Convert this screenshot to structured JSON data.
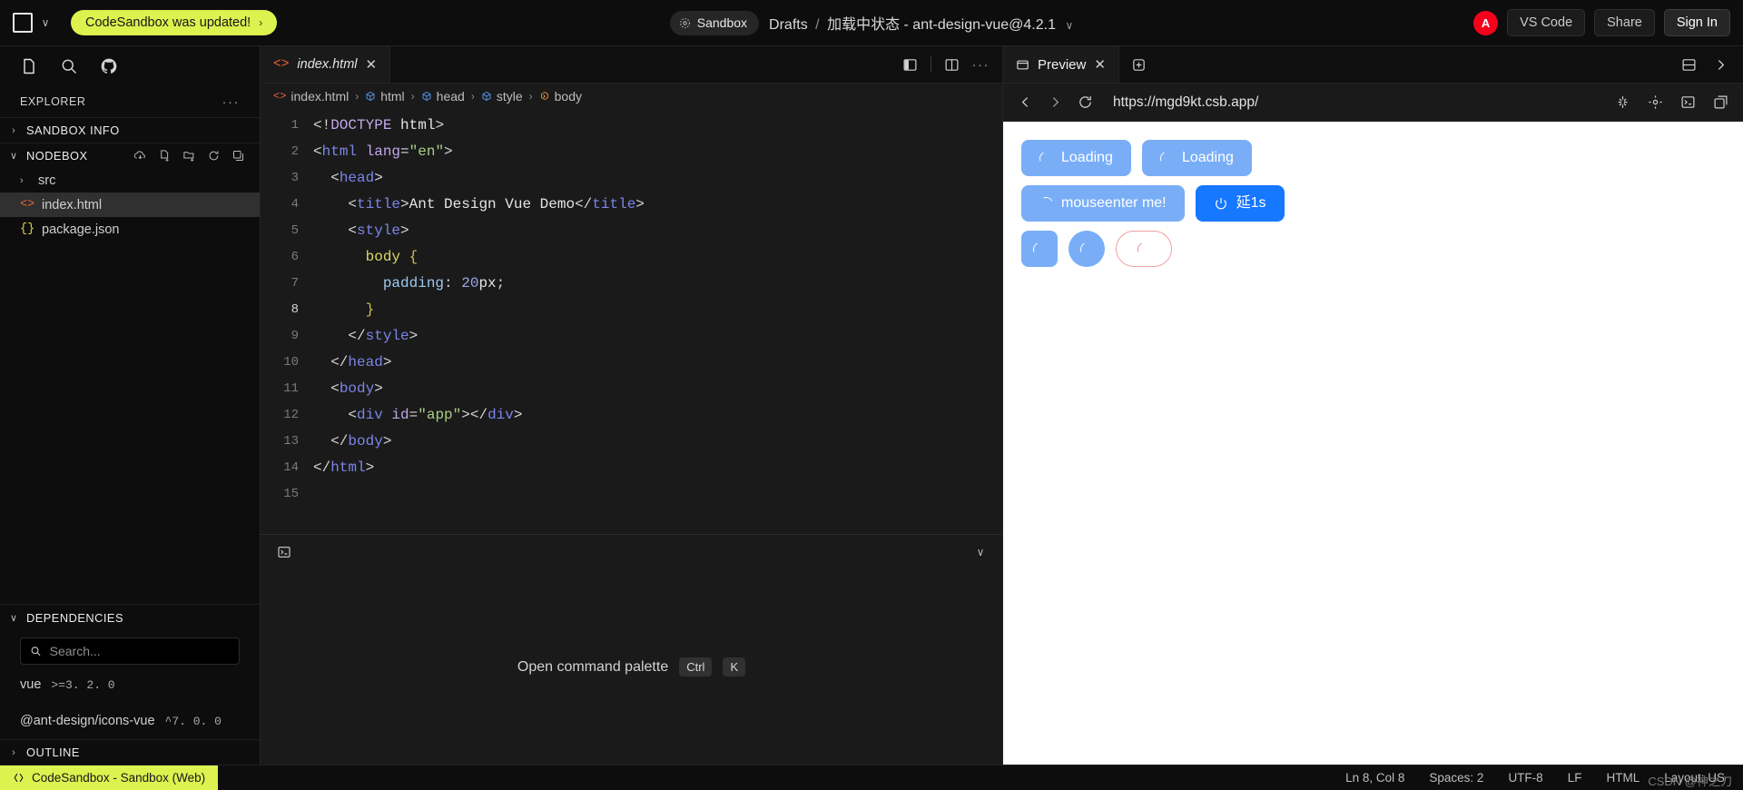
{
  "titlebar": {
    "logo_alt": "CodeSandbox logo",
    "update_banner": "CodeSandbox was updated!",
    "update_arrow": "›",
    "sandbox_chip": "Sandbox",
    "breadcrumb_root": "Drafts",
    "breadcrumb_sep": "/",
    "breadcrumb_name": "加载中状态 - ant-design-vue@4.2.1",
    "title_chevron": "∨",
    "avatar_initial": "A",
    "vscode_button": "VS Code",
    "share_button": "Share",
    "signin_button": "Sign In",
    "accent": "#dcf24f"
  },
  "sidebar": {
    "explorer_label": "EXPLORER",
    "explorer_more": "···",
    "sections": [
      {
        "label": "SANDBOX INFO",
        "caret": "›",
        "expanded": false
      },
      {
        "label": "NODEBOX",
        "caret": "∨",
        "expanded": true
      }
    ],
    "files": [
      {
        "name": "src",
        "type": "folder",
        "caret": "›",
        "icon": "",
        "active": false
      },
      {
        "name": "index.html",
        "type": "file",
        "icon": "<>",
        "active": true
      },
      {
        "name": "package.json",
        "type": "file",
        "icon": "{}",
        "active": false
      }
    ],
    "dependencies_label": "DEPENDENCIES",
    "dependencies_caret": "∨",
    "search_placeholder": "Search...",
    "dependencies": [
      {
        "name": "vue",
        "version": ">=3. 2. 0"
      },
      {
        "name": "@ant-design/icons-vue",
        "version": "^7. 0. 0"
      }
    ],
    "outline_label": "OUTLINE",
    "outline_caret": "›"
  },
  "editor": {
    "tab_name": "index.html",
    "tab_close": "✕",
    "tab_more": "···",
    "breadcrumb": [
      {
        "label": "index.html",
        "icon": "html-file-icon"
      },
      {
        "label": "html",
        "icon": "cube-icon"
      },
      {
        "label": "head",
        "icon": "cube-icon"
      },
      {
        "label": "style",
        "icon": "cube-icon"
      },
      {
        "label": "body",
        "icon": "body-icon"
      }
    ],
    "breadcrumb_separator": "›",
    "lines": [
      {
        "n": "1",
        "text": "<!DOCTYPE html>"
      },
      {
        "n": "2",
        "text": "<html lang=\"en\">"
      },
      {
        "n": "3",
        "text": "  <head>"
      },
      {
        "n": "4",
        "text": "    <title>Ant Design Vue Demo</title>"
      },
      {
        "n": "5",
        "text": "    <style>"
      },
      {
        "n": "6",
        "text": "      body {"
      },
      {
        "n": "7",
        "text": "        padding: 20px;"
      },
      {
        "n": "8",
        "text": "      }"
      },
      {
        "n": "9",
        "text": "    </style>"
      },
      {
        "n": "10",
        "text": "  </head>"
      },
      {
        "n": "11",
        "text": "  <body>"
      },
      {
        "n": "12",
        "text": "    <div id=\"app\"></div>"
      },
      {
        "n": "13",
        "text": "  </body>"
      },
      {
        "n": "14",
        "text": "</html>"
      },
      {
        "n": "15",
        "text": ""
      }
    ],
    "terminal_collapse": "∨",
    "command_palette_text": "Open command palette",
    "kbd_ctrl": "Ctrl",
    "kbd_k": "K"
  },
  "preview": {
    "tab_label": "Preview",
    "tab_close": "✕",
    "add_tab": "+",
    "url": "https://mgd9kt.csb.app/",
    "buttons": {
      "loading_1": "Loading",
      "loading_2": "Loading",
      "mouseenter": "mouseenter me!",
      "delay": "延1s"
    }
  },
  "statusbar": {
    "left_label": "CodeSandbox - Sandbox (Web)",
    "cursor": "Ln 8, Col 8",
    "spaces": "Spaces: 2",
    "encoding": "UTF-8",
    "eol": "LF",
    "language": "HTML",
    "layout": "Layout: US",
    "watermark": "CSDN @神之刀"
  }
}
